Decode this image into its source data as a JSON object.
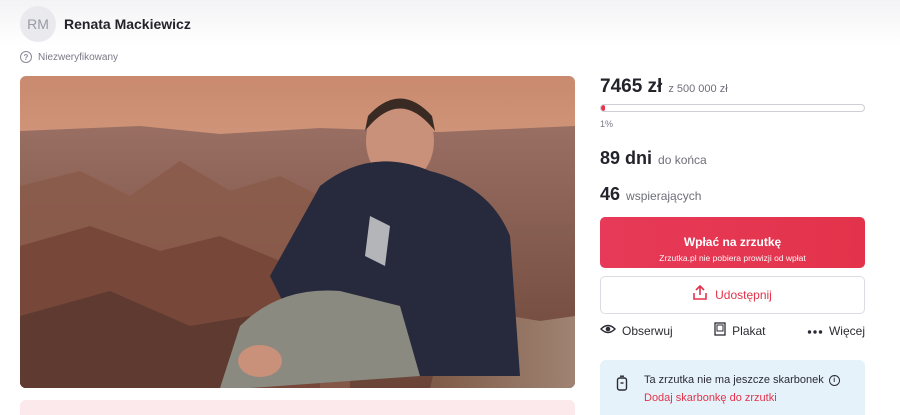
{
  "organizer": {
    "initials": "RM",
    "name": "Renata Mackiewicz",
    "verification": "Niezweryfikowany"
  },
  "campaign": {
    "raised": "7465 zł",
    "target": "z 500 000 zł",
    "progress_fraction": 0.015,
    "percent_label": "1%",
    "days": "89 dni",
    "days_suffix": "do końca",
    "supporters": "46",
    "supporters_suffix": "wspierających"
  },
  "donate": {
    "label": "Wpłać na zrzutkę",
    "sublabel": "Zrzutka.pl nie pobiera prowizji od wpłat"
  },
  "share": {
    "label": "Udostępnij"
  },
  "actions": {
    "follow": "Obserwuj",
    "poster": "Plakat",
    "more": "Więcej"
  },
  "piggybank": {
    "text": "Ta zrzutka nie ma jeszcze skarbonek",
    "link": "Dodaj skarbonkę do zrzutki"
  },
  "colors": {
    "accent": "#e3334b",
    "info_bg": "#e6f2fa"
  },
  "icons": {
    "verify": "question-circle-icon",
    "share": "share-upload-icon",
    "follow": "eye-icon",
    "poster": "poster-icon",
    "more": "dots-icon",
    "piggy": "piggy-bank-icon",
    "info": "info-icon"
  }
}
